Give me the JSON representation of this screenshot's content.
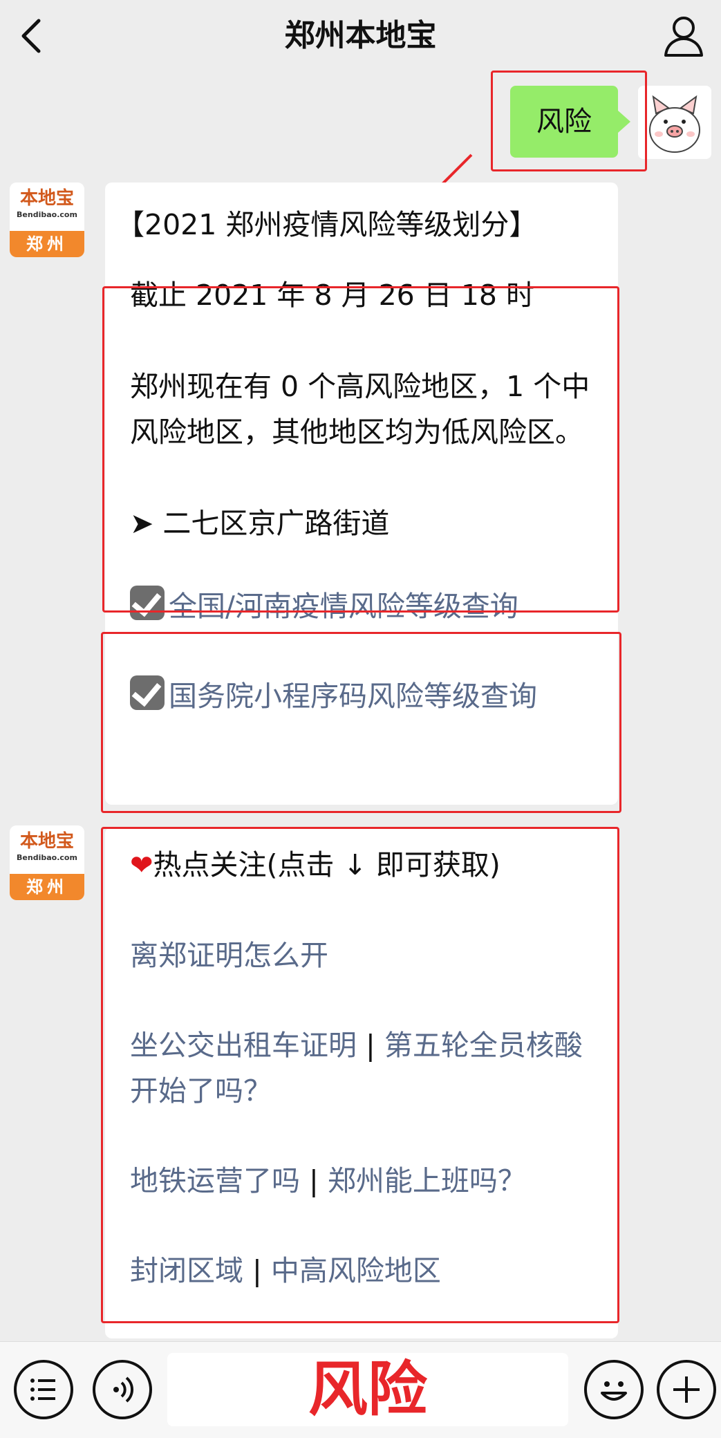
{
  "header": {
    "title": "郑州本地宝",
    "back_icon": "chevron-left-icon",
    "profile_icon": "person-icon"
  },
  "user_message": {
    "text": "风险"
  },
  "bot": {
    "logo_text": "本地宝",
    "logo_en": "Bendibao.com",
    "city": "郑州"
  },
  "message1": {
    "title": "【2021 郑州疫情风险等级划分】",
    "date_line": "截止 2021 年 8 月 26 日 18 时",
    "summary": "郑州现在有 0 个高风险地区，1 个中风险地区，其他地区均为低风险区。",
    "area_bullet": "➤",
    "area": "二七区京广路街道",
    "link1": "全国/河南疫情风险等级查询",
    "link2": "国务院小程序码风险等级查询"
  },
  "message2": {
    "header": "热点关注(点击 ↓ 即可获取)",
    "items": [
      {
        "a": "离郑证明怎么开",
        "sep": "",
        "b": ""
      },
      {
        "a": "坐公交出租车证明",
        "sep": " | ",
        "b": "第五轮全员核酸开始了吗？"
      },
      {
        "a": "地铁运营了吗",
        "sep": " | ",
        "b": "郑州能上班吗？"
      },
      {
        "a": "封闭区域",
        "sep": " | ",
        "b": "中高风险地区"
      }
    ]
  },
  "input": {
    "text": "风险"
  },
  "colors": {
    "annotation_red": "#e8262a",
    "bubble_green": "#95ec69",
    "link_blue": "#596a8a"
  }
}
